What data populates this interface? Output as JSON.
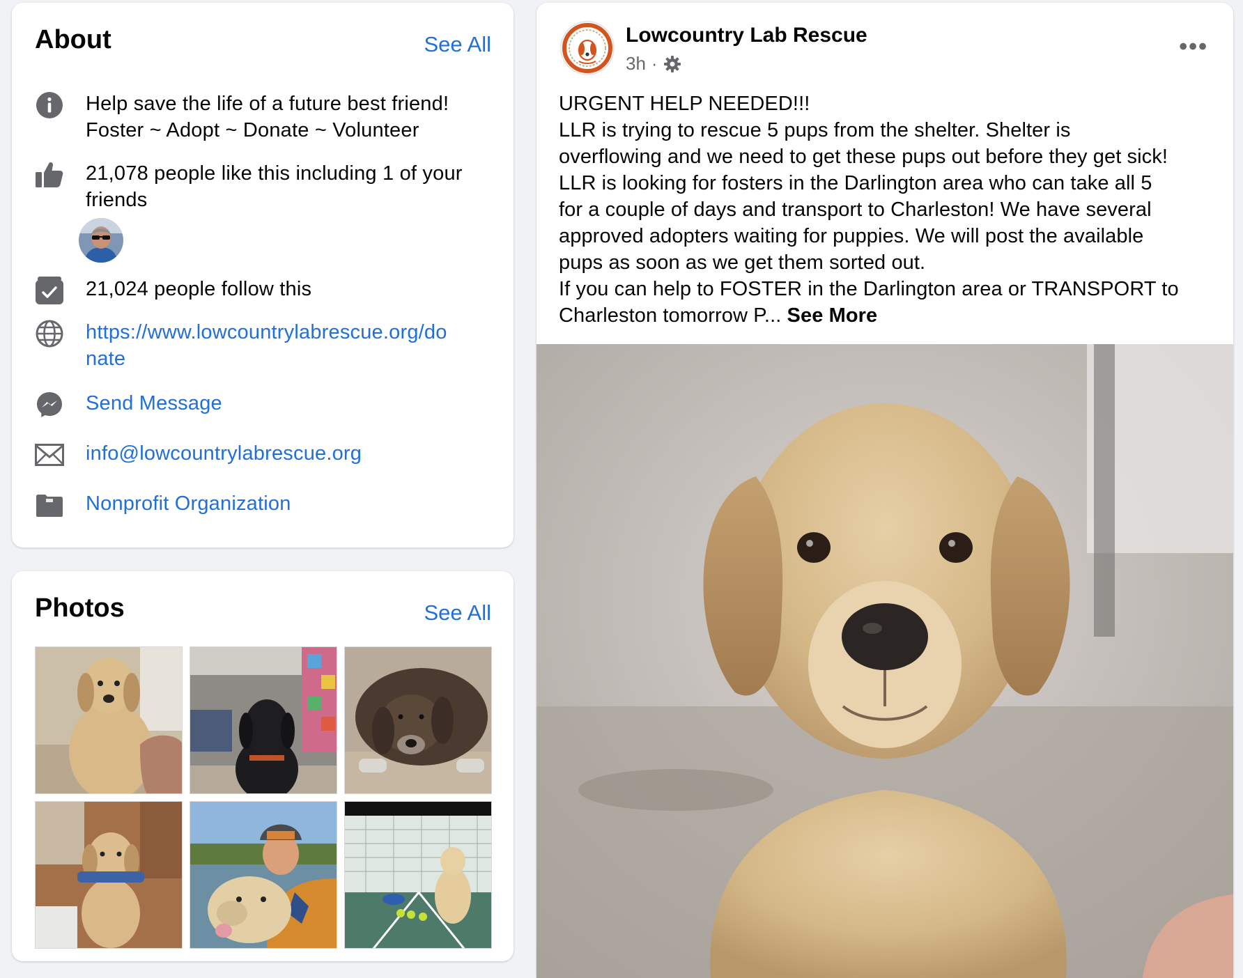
{
  "about": {
    "title": "About",
    "see_all": "See All",
    "description_line1": "Help save the life of a future best friend!",
    "description_line2": "Foster ~ Adopt ~ Donate ~ Volunteer",
    "likes_line1": "21,078 people like this including 1 of your",
    "likes_line2": "friends",
    "follows": "21,024 people follow this",
    "website_line1": "https://www.lowcountrylabrescue.org/do",
    "website_line2": "nate",
    "send_message": "Send Message",
    "email": "info@lowcountrylabrescue.org",
    "category": "Nonprofit Organization"
  },
  "photos": {
    "title": "Photos",
    "see_all": "See All"
  },
  "post": {
    "page_name": "Lowcountry Lab Rescue",
    "time": "3h",
    "separator": "·",
    "more": "•••",
    "lines": [
      "URGENT HELP NEEDED!!!",
      "LLR is trying to rescue 5 pups from the shelter.  Shelter is",
      "overflowing and we need to get these pups out before they get sick!",
      "LLR is looking for fosters in the Darlington area who can take all 5",
      "for a couple of days and transport to Charleston!  We have several",
      "approved adopters waiting for puppies.  We will post the available",
      "pups as soon as we get them sorted out.",
      "If you can help to FOSTER in the Darlington area or TRANSPORT to"
    ],
    "last_line": "Charleston tomorrow P... ",
    "see_more": "See More"
  },
  "colors": {
    "link": "#216fdb",
    "icon_gray": "#65676b"
  },
  "icons": {
    "info": "info-icon",
    "like": "thumbs-up-icon",
    "follow": "follow-check-icon",
    "website": "globe-icon",
    "messenger": "messenger-icon",
    "email": "envelope-icon",
    "category": "briefcase-icon",
    "privacy": "gear-icon"
  }
}
